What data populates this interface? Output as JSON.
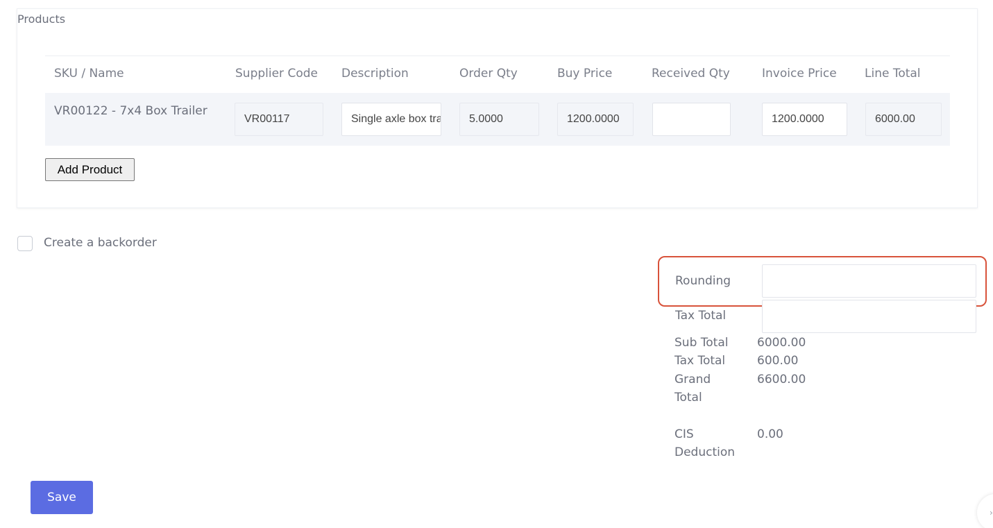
{
  "products": {
    "title": "Products",
    "columns": [
      "SKU / Name",
      "Supplier Code",
      "Description",
      "Order Qty",
      "Buy Price",
      "Received Qty",
      "Invoice Price",
      "Line Total"
    ],
    "rows": [
      {
        "sku_name": "VR00122 - 7x4 Box Trailer",
        "supplier_code": "VR00117",
        "description": "Single axle box trailer",
        "order_qty": "5.0000",
        "buy_price": "1200.0000",
        "received_qty": "",
        "invoice_price": "1200.0000",
        "line_total": "6000.00"
      }
    ],
    "add_product_label": "Add Product"
  },
  "backorder": {
    "label": "Create a backorder",
    "checked": false
  },
  "summary": {
    "rounding_label": "Rounding",
    "rounding_value": "",
    "tax_total_input_label": "Tax Total",
    "tax_total_input_value": "",
    "sub_total_label": "Sub Total",
    "sub_total_value": "6000.00",
    "tax_total_label": "Tax Total",
    "tax_total_value": "600.00",
    "grand_total_label_1": "Grand",
    "grand_total_label_2": "Total",
    "grand_total_value": "6600.00",
    "cis_label_1": "CIS",
    "cis_label_2": "Deduction",
    "cis_value": "0.00"
  },
  "save_label": "Save",
  "fab_icon": "chevron-icon",
  "colors": {
    "accent": "#5b6ce2",
    "highlight": "#d8523a"
  }
}
